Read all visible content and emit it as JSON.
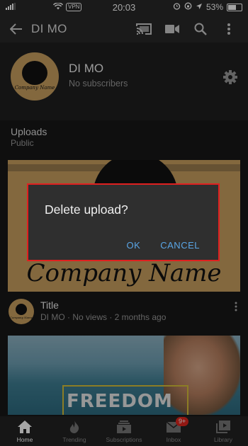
{
  "status_bar": {
    "time": "20:03",
    "vpn": "VPN",
    "battery": "53%",
    "battery_level": 0.53
  },
  "app_bar": {
    "title": "DI MO"
  },
  "channel": {
    "name": "DI MO",
    "subscribers": "No subscribers",
    "avatar_text": "Company Name"
  },
  "uploads": {
    "title": "Uploads",
    "visibility": "Public"
  },
  "videos": [
    {
      "thumbnail_text": "Company Name",
      "title": "Title",
      "meta": "DI MO · No views · 2 months ago",
      "avatar_text": "Company Name"
    },
    {
      "thumbnail_text": "FREEDOM"
    }
  ],
  "bottom_nav": {
    "items": [
      {
        "label": "Home"
      },
      {
        "label": "Trending"
      },
      {
        "label": "Subscriptions"
      },
      {
        "label": "Inbox",
        "badge": "9+"
      },
      {
        "label": "Library"
      }
    ]
  },
  "dialog": {
    "title": "Delete upload?",
    "ok": "OK",
    "cancel": "CANCEL"
  },
  "colors": {
    "background": "#181818",
    "accent_link": "#5aa6e6",
    "badge": "#e0261e",
    "highlight_border": "#e02020"
  }
}
